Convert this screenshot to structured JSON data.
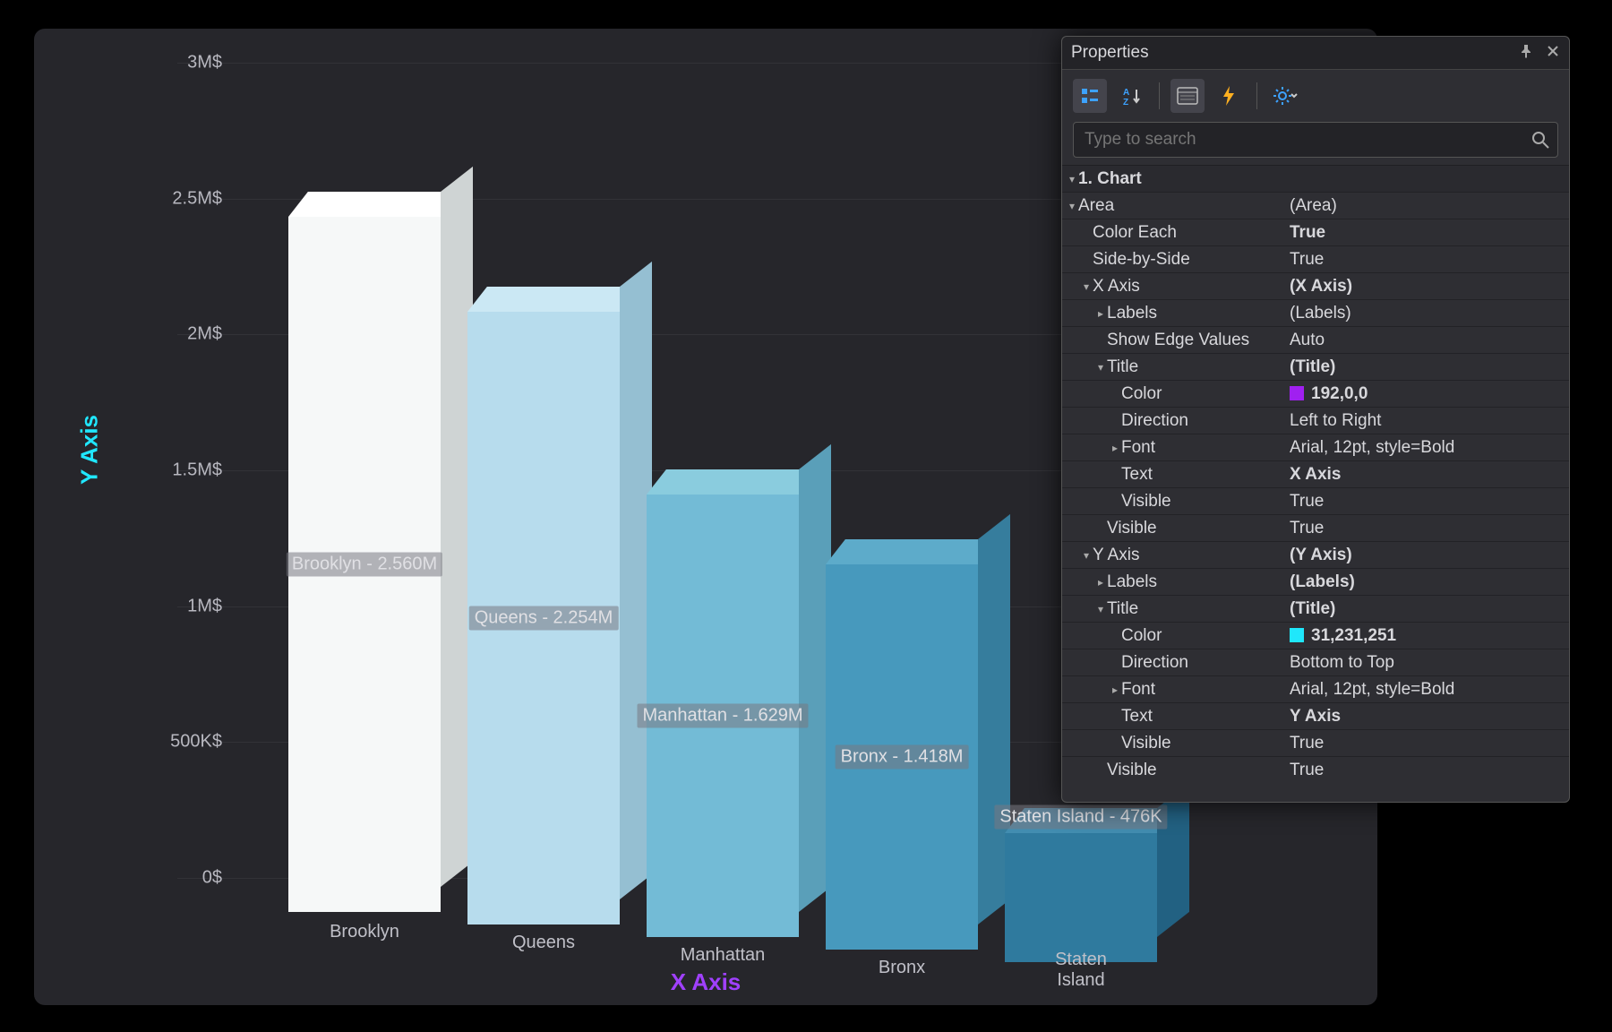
{
  "chart_data": {
    "type": "bar",
    "title": "",
    "xlabel": "X Axis",
    "ylabel": "Y Axis",
    "ylim": [
      0,
      3000000
    ],
    "y_ticks": [
      "0$",
      "500K$",
      "1M$",
      "1.5M$",
      "2M$",
      "2.5M$",
      "3M$"
    ],
    "categories": [
      "Brooklyn",
      "Queens",
      "Manhattan",
      "Bronx",
      "Staten Island"
    ],
    "values": [
      2560000,
      2254000,
      1629000,
      1418000,
      476000
    ],
    "data_labels": [
      "Brooklyn - 2.560M",
      "Queens - 2.254M",
      "Manhattan - 1.629M",
      "Bronx - 1.418M",
      "Staten Island - 476K"
    ],
    "bar_colors": [
      "#f6f8f8",
      "#b7dced",
      "#73bbd6",
      "#4799bd",
      "#2f7a9e"
    ]
  },
  "panel": {
    "title": "Properties",
    "search_placeholder": "Type to search"
  },
  "props": {
    "chart_header": "1. Chart",
    "area": {
      "label": "Area",
      "value": "(Area)",
      "color_each": {
        "label": "Color Each",
        "value": "True"
      },
      "side_by_side": {
        "label": "Side-by-Side",
        "value": "True"
      },
      "xaxis": {
        "label": "X Axis",
        "value": "(X Axis)",
        "labels": {
          "label": "Labels",
          "value": "(Labels)"
        },
        "show_edge": {
          "label": "Show Edge Values",
          "value": "Auto"
        },
        "title": {
          "label": "Title",
          "value": "(Title)",
          "color": {
            "label": "Color",
            "value": "192,0,0",
            "swatch": "#a020f0"
          },
          "direction": {
            "label": "Direction",
            "value": "Left to Right"
          },
          "font": {
            "label": "Font",
            "value": "Arial, 12pt, style=Bold"
          },
          "text": {
            "label": "Text",
            "value": "X Axis"
          },
          "visible": {
            "label": "Visible",
            "value": "True"
          }
        },
        "visible": {
          "label": "Visible",
          "value": "True"
        }
      },
      "yaxis": {
        "label": "Y Axis",
        "value": "(Y Axis)",
        "labels": {
          "label": "Labels",
          "value": "(Labels)"
        },
        "title": {
          "label": "Title",
          "value": "(Title)",
          "color": {
            "label": "Color",
            "value": "31,231,251",
            "swatch": "#1fe7fb"
          },
          "direction": {
            "label": "Direction",
            "value": "Bottom to Top"
          },
          "font": {
            "label": "Font",
            "value": "Arial, 12pt, style=Bold"
          },
          "text": {
            "label": "Text",
            "value": "Y Axis"
          },
          "visible": {
            "label": "Visible",
            "value": "True"
          }
        },
        "visible": {
          "label": "Visible",
          "value": "True"
        }
      }
    }
  }
}
